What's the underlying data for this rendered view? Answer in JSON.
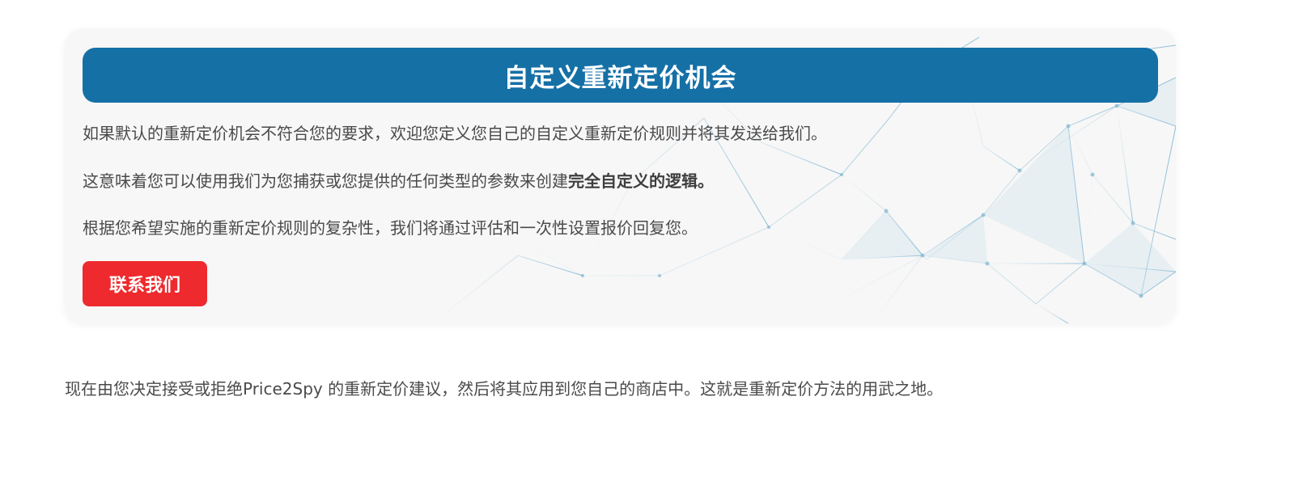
{
  "card": {
    "title": "自定义重新定价机会",
    "paragraph1": "如果默认的重新定价机会不符合您的要求，欢迎您定义您自己的自定义重新定价规则并将其发送给我们。",
    "paragraph2_prefix": "这意味着您可以使用我们为您捕获或您提供的任何类型的参数来创建",
    "paragraph2_bold": "完全自定义的逻辑。",
    "paragraph3": "根据您希望实施的重新定价规则的复杂性，我们将通过评估和一次性设置报价回复您。",
    "contact_button_label": "联系我们"
  },
  "footer_text": "现在由您决定接受或拒绝Price2Spy 的重新定价建议，然后将其应用到您自己的商店中。这就是重新定价方法的用武之地。",
  "colors": {
    "banner": "#1570a6",
    "button": "#ee2a2e",
    "text": "#4a4a4a",
    "card_bg": "#f7f7f7"
  }
}
